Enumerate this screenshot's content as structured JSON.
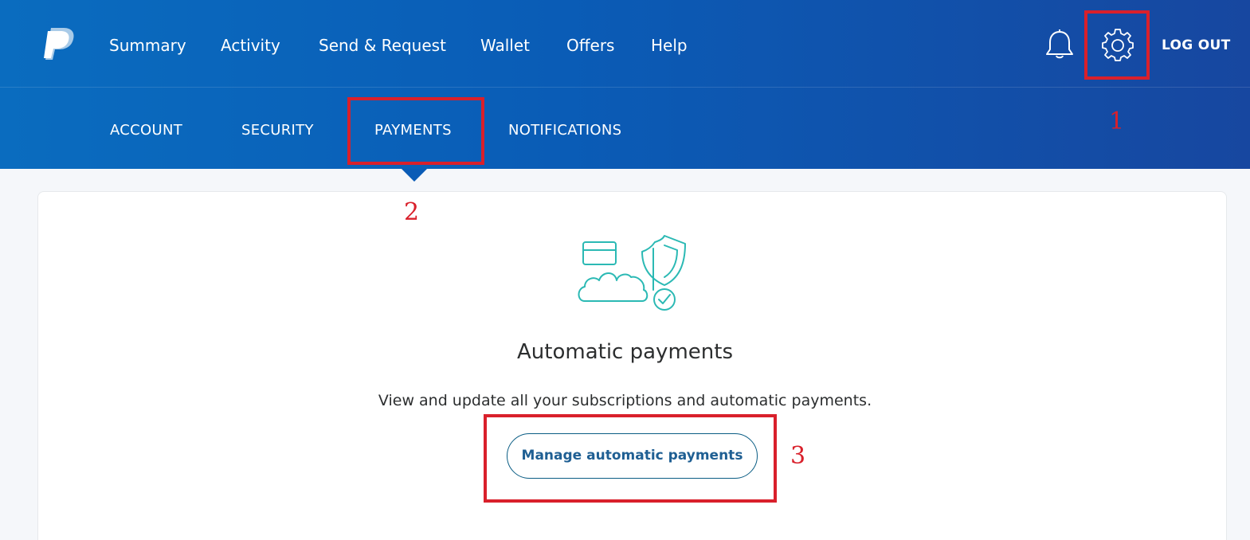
{
  "header": {
    "main_nav": [
      {
        "label": "Summary"
      },
      {
        "label": "Activity"
      },
      {
        "label": "Send & Request"
      },
      {
        "label": "Wallet"
      },
      {
        "label": "Offers"
      },
      {
        "label": "Help"
      }
    ],
    "logout_label": "LOG OUT",
    "icons": [
      "bell-icon",
      "gear-icon"
    ],
    "sub_nav": [
      {
        "label": "ACCOUNT"
      },
      {
        "label": "SECURITY"
      },
      {
        "label": "PAYMENTS",
        "active": true
      },
      {
        "label": "NOTIFICATIONS"
      }
    ]
  },
  "annotations": [
    {
      "number": "1"
    },
    {
      "number": "2"
    },
    {
      "number": "3"
    }
  ],
  "card": {
    "title": "Automatic payments",
    "description": "View and update all your subscriptions and automatic payments.",
    "button_label": "Manage automatic payments"
  },
  "colors": {
    "header_gradient_start": "#0a6cbf",
    "header_gradient_end": "#1747a0",
    "annotation_red": "#d9202b",
    "illustration_teal": "#2bb9b4",
    "button_text": "#1f5f93"
  }
}
